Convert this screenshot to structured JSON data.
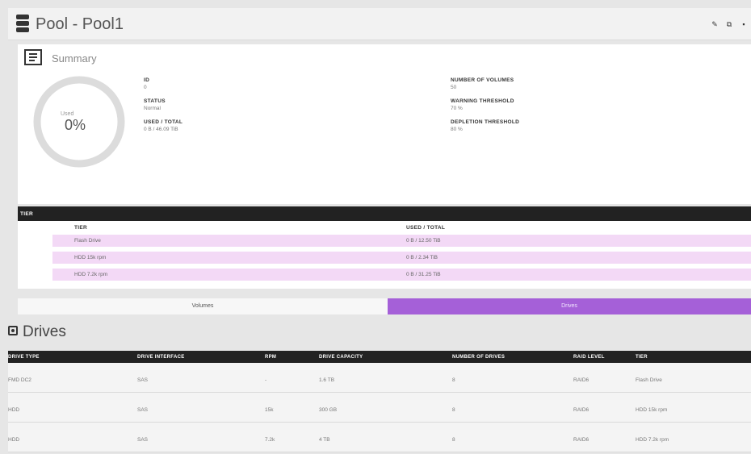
{
  "header": {
    "title": "Pool - Pool1",
    "actions": [
      {
        "icon": "edit-icon",
        "glyph": "✎"
      },
      {
        "icon": "external-link-icon",
        "glyph": "⧉"
      },
      {
        "icon": "delete-icon",
        "glyph": "▪"
      }
    ]
  },
  "summary": {
    "title": "Summary",
    "donut": {
      "label": "Used",
      "value": "0%",
      "used_fraction": 0
    },
    "fields": {
      "id": {
        "label": "ID",
        "value": "0"
      },
      "status": {
        "label": "STATUS",
        "value": "Normal"
      },
      "used_total": {
        "label": "USED / TOTAL",
        "value": "0 B / 46.09 TiB"
      },
      "num_volumes": {
        "label": "NUMBER OF VOLUMES",
        "value": "50"
      },
      "warning": {
        "label": "WARNING THRESHOLD",
        "value": "70 %"
      },
      "depletion": {
        "label": "DEPLETION THRESHOLD",
        "value": "80 %"
      }
    }
  },
  "tier": {
    "bar_label": "TIER",
    "columns": [
      "TIER",
      "USED / TOTAL"
    ],
    "rows": [
      {
        "tier": "Flash Drive",
        "used_total": "0 B / 12.50 TiB"
      },
      {
        "tier": "HDD 15k rpm",
        "used_total": "0 B / 2.34 TiB"
      },
      {
        "tier": "HDD 7.2k rpm",
        "used_total": "0 B / 31.25 TiB"
      }
    ]
  },
  "tabs": {
    "volumes": "Volumes",
    "drives": "Drives",
    "active": "drives"
  },
  "drives": {
    "title": "Drives",
    "columns": [
      "DRIVE TYPE",
      "DRIVE INTERFACE",
      "RPM",
      "DRIVE CAPACITY",
      "NUMBER OF DRIVES",
      "RAID LEVEL",
      "TIER"
    ],
    "rows": [
      {
        "type": "FMD DC2",
        "interface": "SAS",
        "rpm": "-",
        "capacity": "1.6 TB",
        "count": "8",
        "raid": "RAID6",
        "tier": "Flash Drive"
      },
      {
        "type": "HDD",
        "interface": "SAS",
        "rpm": "15k",
        "capacity": "300 GB",
        "count": "8",
        "raid": "RAID6",
        "tier": "HDD 15k rpm"
      },
      {
        "type": "HDD",
        "interface": "SAS",
        "rpm": "7.2k",
        "capacity": "4 TB",
        "count": "8",
        "raid": "RAID6",
        "tier": "HDD 7.2k rpm"
      }
    ]
  },
  "colors": {
    "accent": "#a560d8",
    "tier_row": "#f3d9f6",
    "header_bar": "#222222",
    "donut_track": "#dcdcdc"
  }
}
